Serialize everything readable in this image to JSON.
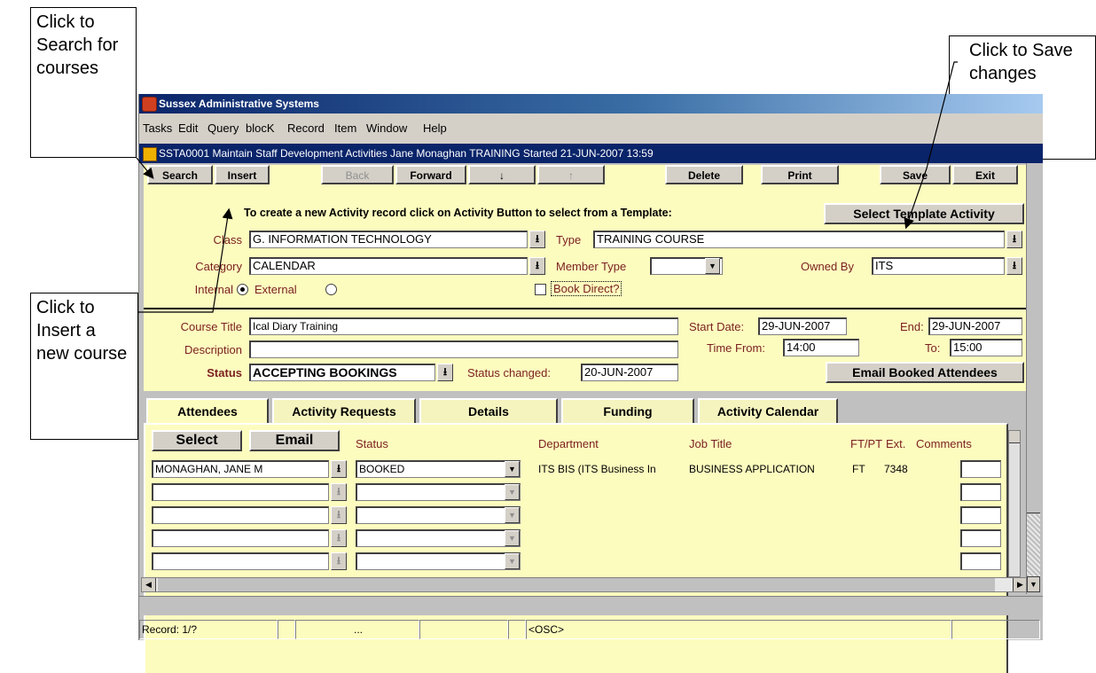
{
  "callouts": {
    "search": "Click to Search for courses",
    "save": "Click to Save changes",
    "insert": "Click to Insert a new course"
  },
  "app_title": "Sussex Administrative Systems",
  "menu": [
    "Tasks",
    "Edit",
    "Query",
    "blocK",
    "Record",
    "Item",
    "Window",
    "Help"
  ],
  "form_title": "SSTA0001 Maintain Staff Development Activities  Jane Monaghan TRAINING  Started 21-JUN-2007 13:59",
  "toolbar": {
    "search": "Search",
    "insert": "Insert",
    "back": "Back",
    "forward": "Forward",
    "down": "↓",
    "up": "↑",
    "delete": "Delete",
    "print": "Print",
    "save": "Save",
    "exit": "Exit"
  },
  "instruction": "To create a new Activity record click on Activity Button to select from a Template:",
  "select_template": "Select Template Activity",
  "fields": {
    "class_label": "Class",
    "class_value": "G. INFORMATION TECHNOLOGY",
    "type_label": "Type",
    "type_value": "TRAINING COURSE",
    "category_label": "Category",
    "category_value": "CALENDAR",
    "member_type_label": "Member Type",
    "member_type_value": "",
    "owned_by_label": "Owned By",
    "owned_by_value": "ITS",
    "internal_label": "Internal",
    "external_label": "External",
    "book_direct_label": "Book Direct?",
    "course_title_label": "Course Title",
    "course_title_value": "Ical Diary Training",
    "description_label": "Description",
    "description_value": "",
    "start_date_label": "Start Date:",
    "start_date_value": "29-JUN-2007",
    "end_label": "End:",
    "end_value": "29-JUN-2007",
    "time_from_label": "Time From:",
    "time_from_value": "14:00",
    "to_label": "To:",
    "to_value": "15:00",
    "status_label": "Status",
    "status_value": "ACCEPTING BOOKINGS",
    "status_changed_label": "Status changed:",
    "status_changed_value": "20-JUN-2007"
  },
  "email_booked": "Email Booked Attendees",
  "tabs": [
    "Attendees",
    "Activity Requests",
    "Details",
    "Funding",
    "Activity Calendar"
  ],
  "attendees": {
    "select": "Select",
    "email": "Email",
    "columns": {
      "status": "Status",
      "department": "Department",
      "job_title": "Job Title",
      "ftpt": "FT/PT",
      "ext": "Ext.",
      "comments": "Comments"
    },
    "row1": {
      "name": "MONAGHAN, JANE M",
      "status": "BOOKED",
      "department": "ITS BIS (ITS Business In",
      "job_title": "BUSINESS APPLICATION",
      "ftpt": "FT",
      "ext": "7348"
    }
  },
  "statusbar": {
    "record": "Record: 1/?",
    "ellipsis": "...",
    "osc": "<OSC>"
  }
}
